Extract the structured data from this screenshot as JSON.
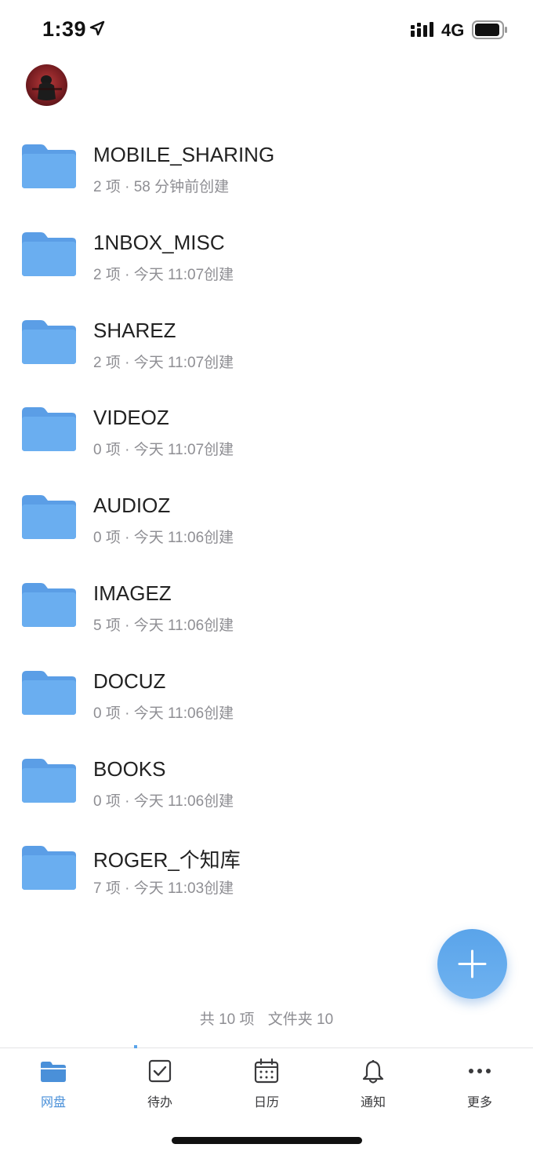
{
  "status_bar": {
    "time": "1:39",
    "network": "4G"
  },
  "colors": {
    "accent": "#4a90d9",
    "folder": "#6aaef0",
    "folder_back": "#5b9ee6",
    "meta_text": "#8e8e93"
  },
  "folders": [
    {
      "name": "MOBILE_SHARING",
      "meta": "2 项 · 58 分钟前创建"
    },
    {
      "name": "1NBOX_MISC",
      "meta": "2 项 · 今天 11:07创建"
    },
    {
      "name": "SHAREZ",
      "meta": "2 项 · 今天 11:07创建"
    },
    {
      "name": "VIDEOZ",
      "meta": "0 项 · 今天 11:07创建"
    },
    {
      "name": "AUDIOZ",
      "meta": "0 项 · 今天 11:06创建"
    },
    {
      "name": "IMAGEZ",
      "meta": "5 项 · 今天 11:06创建"
    },
    {
      "name": "DOCUZ",
      "meta": "0 项 · 今天 11:06创建"
    },
    {
      "name": "BOOKS",
      "meta": "0 项 · 今天 11:06创建"
    },
    {
      "name": "ROGER_个知库",
      "meta": "7 项 · 今天 11:03创建"
    }
  ],
  "summary": {
    "total": "共 10 项",
    "folders": "文件夹 10"
  },
  "tabs": [
    {
      "label": "网盘",
      "icon": "folder-icon",
      "active": true
    },
    {
      "label": "待办",
      "icon": "checkbox-icon",
      "active": false
    },
    {
      "label": "日历",
      "icon": "calendar-icon",
      "active": false
    },
    {
      "label": "通知",
      "icon": "bell-icon",
      "active": false
    },
    {
      "label": "更多",
      "icon": "more-icon",
      "active": false
    }
  ]
}
